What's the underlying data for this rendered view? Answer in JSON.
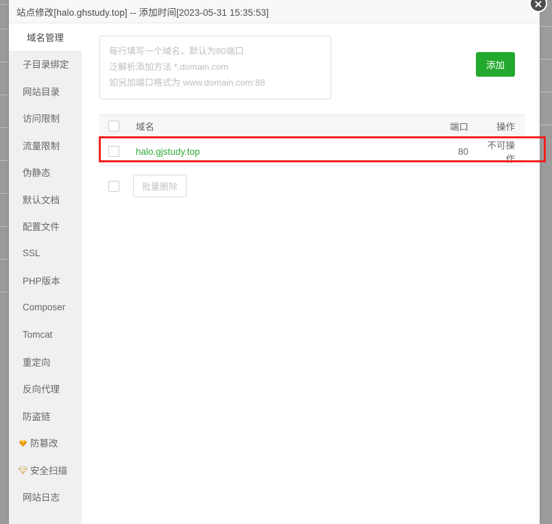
{
  "window": {
    "title": "站点修改[halo.ghstudy.top] -- 添加时间[2023-05-31 15:35:53]",
    "close_label": "×"
  },
  "colors": {
    "accent_green": "#23a92e",
    "link_green": "#2eaa37",
    "highlight_red": "#f32020",
    "sidebar_bg": "#f0f0f0",
    "header_bg": "#f8f8f8",
    "backdrop_grey": "#9a9a9a"
  },
  "sidebar": {
    "items": [
      {
        "label": "域名管理",
        "active": true,
        "icon": ""
      },
      {
        "label": "子目录绑定",
        "active": false,
        "icon": ""
      },
      {
        "label": "网站目录",
        "active": false,
        "icon": ""
      },
      {
        "label": "访问限制",
        "active": false,
        "icon": ""
      },
      {
        "label": "流量限制",
        "active": false,
        "icon": ""
      },
      {
        "label": "伪静态",
        "active": false,
        "icon": ""
      },
      {
        "label": "默认文档",
        "active": false,
        "icon": ""
      },
      {
        "label": "配置文件",
        "active": false,
        "icon": ""
      },
      {
        "label": "SSL",
        "active": false,
        "icon": ""
      },
      {
        "label": "PHP版本",
        "active": false,
        "icon": ""
      },
      {
        "label": "Composer",
        "active": false,
        "icon": ""
      },
      {
        "label": "Tomcat",
        "active": false,
        "icon": ""
      },
      {
        "label": "重定向",
        "active": false,
        "icon": ""
      },
      {
        "label": "反向代理",
        "active": false,
        "icon": ""
      },
      {
        "label": "防盗链",
        "active": false,
        "icon": ""
      },
      {
        "label": "防篡改",
        "active": false,
        "icon": "gem-gold-icon"
      },
      {
        "label": "安全扫描",
        "active": false,
        "icon": "gem-pale-icon"
      },
      {
        "label": "网站日志",
        "active": false,
        "icon": ""
      }
    ]
  },
  "add_panel": {
    "textarea_value": "",
    "textarea_placeholder": "每行填写一个域名，默认为80端口\n泛解析添加方法 *.domain.com\n如另加端口格式为 www.domain.com:88",
    "add_button_label": "添加"
  },
  "table": {
    "headers": {
      "select_all": "",
      "domain": "域名",
      "port": "端口",
      "operation": "操作"
    },
    "rows": [
      {
        "checked": false,
        "domain": "halo.gjstudy.top",
        "port": "80",
        "operation": "不可操作"
      }
    ]
  },
  "bulk": {
    "checkbox_checked": false,
    "delete_label": "批量删除"
  }
}
